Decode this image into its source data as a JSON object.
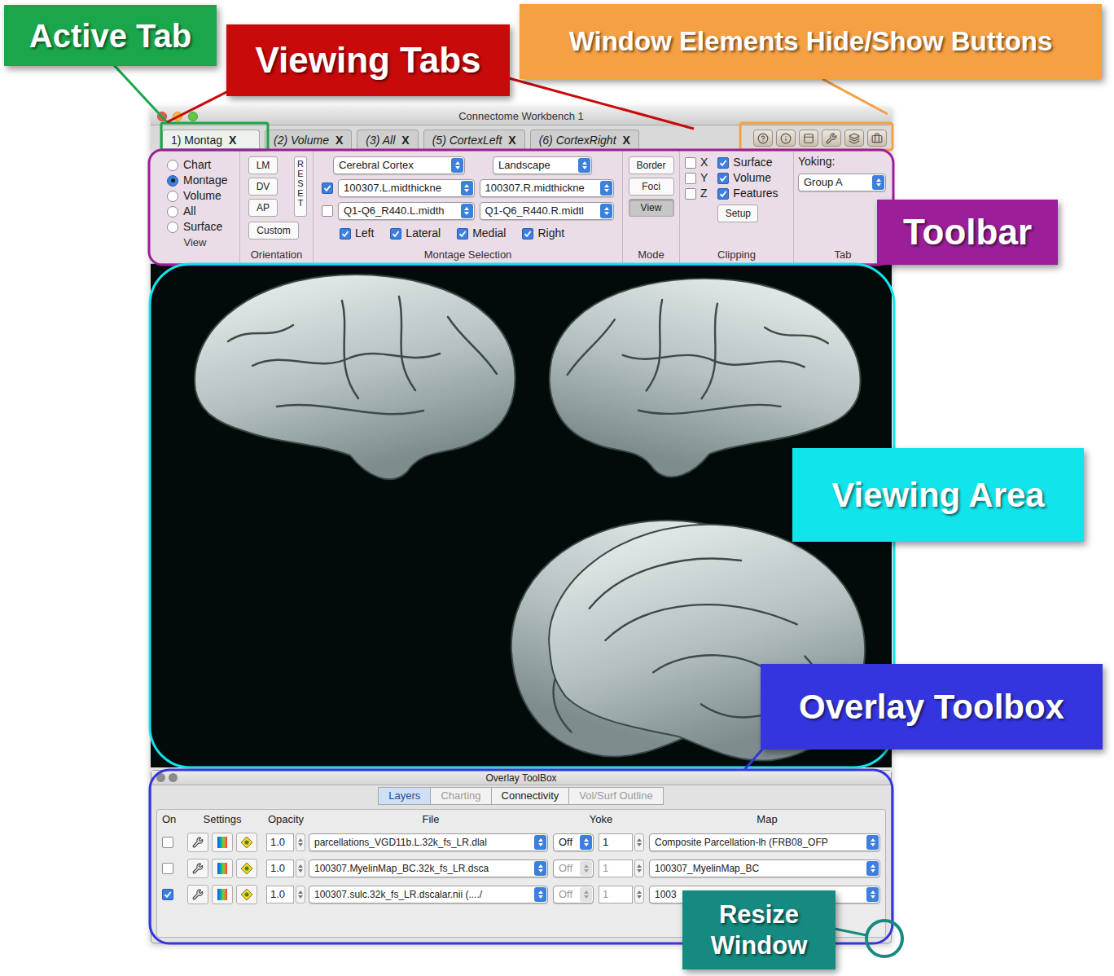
{
  "annotations": [
    {
      "label": "Active Tab",
      "color": "#1aa64a"
    },
    {
      "label": "Viewing Tabs",
      "color": "#c80a0a"
    },
    {
      "label": "Window Elements Hide/Show Buttons",
      "color": "#f5a043"
    },
    {
      "label": "Toolbar",
      "color": "#9a1f98"
    },
    {
      "label": "Viewing Area",
      "color": "#12e4ec"
    },
    {
      "label": "Overlay Toolbox",
      "color": "#3535e0"
    },
    {
      "label": "Resize Window",
      "color": "#168a80"
    }
  ],
  "window": {
    "title": "Connectome Workbench 1"
  },
  "tab_close": "X",
  "tabs": [
    {
      "label": "1) Montag",
      "selected": true
    },
    {
      "label": "(2) Volume",
      "selected": false
    },
    {
      "label": "(3) All",
      "selected": false
    },
    {
      "label": "(5) CortexLeft",
      "selected": false
    },
    {
      "label": "(6) CortexRight",
      "selected": false
    }
  ],
  "toolbar": {
    "view": {
      "title": "View",
      "options": [
        {
          "label": "Chart",
          "selected": false
        },
        {
          "label": "Montage",
          "selected": true
        },
        {
          "label": "Volume",
          "selected": false
        },
        {
          "label": "All",
          "selected": false
        },
        {
          "label": "Surface",
          "selected": false
        }
      ]
    },
    "orientation": {
      "title": "Orientation",
      "buttons": [
        "LM",
        "DV",
        "AP"
      ],
      "custom": "Custom",
      "reset": "RESET"
    },
    "montage": {
      "title": "Montage Selection",
      "structure": "Cerebral Cortex",
      "layout": "Landscape",
      "rows": [
        {
          "checked": true,
          "left": "100307.L.midthickne",
          "right": "100307.R.midthickne"
        },
        {
          "checked": false,
          "left": "Q1-Q6_R440.L.midth",
          "right": "Q1-Q6_R440.R.midtl"
        }
      ],
      "views": [
        {
          "label": "Left",
          "checked": true
        },
        {
          "label": "Lateral",
          "checked": true
        },
        {
          "label": "Medial",
          "checked": true
        },
        {
          "label": "Right",
          "checked": true
        }
      ]
    },
    "mode": {
      "title": "Mode",
      "buttons": [
        {
          "label": "Border",
          "selected": false
        },
        {
          "label": "Foci",
          "selected": false
        },
        {
          "label": "View",
          "selected": true
        }
      ]
    },
    "clipping": {
      "title": "Clipping",
      "axes": [
        {
          "label": "X",
          "checked": false
        },
        {
          "label": "Y",
          "checked": false
        },
        {
          "label": "Z",
          "checked": false
        }
      ],
      "features": [
        {
          "label": "Surface",
          "checked": true
        },
        {
          "label": "Volume",
          "checked": true
        },
        {
          "label": "Features",
          "checked": true
        }
      ],
      "setup": "Setup"
    },
    "tab": {
      "title": "Tab",
      "yoking_label": "Yoking:",
      "yoking": "Group A"
    }
  },
  "overlay": {
    "title": "Overlay ToolBox",
    "tabs": [
      {
        "label": "Layers",
        "selected": true,
        "disabled": false
      },
      {
        "label": "Charting",
        "selected": false,
        "disabled": true
      },
      {
        "label": "Connectivity",
        "selected": false,
        "disabled": false
      },
      {
        "label": "Vol/Surf Outline",
        "selected": false,
        "disabled": true
      }
    ],
    "columns": [
      "On",
      "Settings",
      "Opacity",
      "File",
      "Yoke",
      "Map"
    ],
    "rows": [
      {
        "on": false,
        "opacity": "1.0",
        "file": "parcellations_VGD11b.L.32k_fs_LR.dlal",
        "yoke": "Off",
        "yoke_enabled": true,
        "index": "1",
        "map": "Composite Parcellation-lh (FRB08_OFP"
      },
      {
        "on": false,
        "opacity": "1.0",
        "file": "100307.MyelinMap_BC.32k_fs_LR.dsca",
        "yoke": "Off",
        "yoke_enabled": false,
        "index": "1",
        "map": "100307_MyelinMap_BC"
      },
      {
        "on": true,
        "opacity": "1.0",
        "file": "100307.sulc.32k_fs_LR.dscalar.nii (..../",
        "yoke": "Off",
        "yoke_enabled": false,
        "index": "1",
        "map": "1003"
      }
    ]
  }
}
